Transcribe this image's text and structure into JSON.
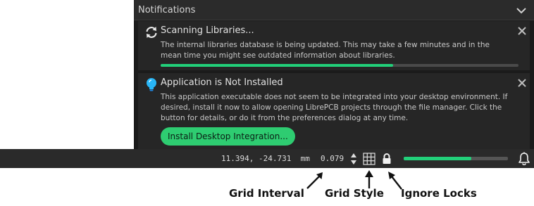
{
  "notifications": {
    "header_title": "Notifications",
    "header_icon": "chevron-down-icon",
    "items": [
      {
        "icon": "sync-icon",
        "title": "Scanning Libraries...",
        "body": "The internal libraries database is being updated. This may take a few minutes and in the mean time you might see outdated information about libraries.",
        "progress": 0.65
      },
      {
        "icon": "lightbulb-icon",
        "title": "Application is Not Installed",
        "body": "This application executable does not seem to be integrated into your desktop environment. If desired, install it now to allow opening LibrePCB projects through the file manager. Click the button for details, or do it from the preferences dialog at any time.",
        "button_label": "Install Desktop Integration..."
      }
    ]
  },
  "statusbar": {
    "coordinates": "11.394, -24.731",
    "unit": "mm",
    "grid_interval": "0.079",
    "progress": 0.65,
    "icons": [
      "stepper-icon",
      "grid-icon",
      "lock-icon",
      "bell-icon"
    ]
  },
  "annotations": {
    "grid_interval": "Grid Interval",
    "grid_style": "Grid Style",
    "ignore_locks": "Ignore Locks"
  },
  "colors": {
    "accent": "#2ecc71",
    "progress": "#22d07a",
    "icon_blue": "#29b6f6",
    "panel_bg": "#1b1b1b",
    "statusbar_bg": "#2a2a2a"
  }
}
